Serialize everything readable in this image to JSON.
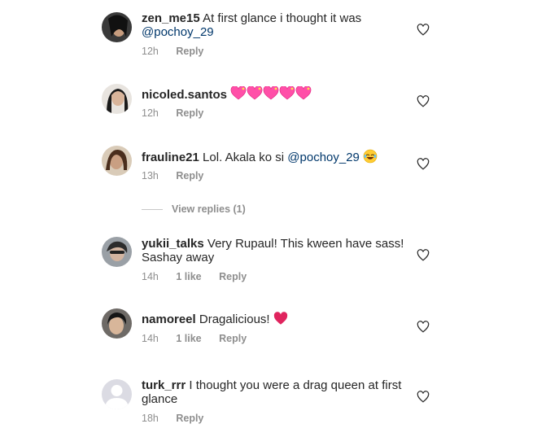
{
  "comments": [
    {
      "username": "zen_me15",
      "text": "At first glance i thought it was",
      "mention": "@pochoy_29",
      "time": "12h",
      "likes": "",
      "reply": "Reply"
    },
    {
      "username": "nicoled.santos",
      "text": "",
      "emoji": "5 sparkling pink hearts",
      "time": "12h",
      "likes": "",
      "reply": "Reply"
    },
    {
      "username": "frauline21",
      "text": "Lol. Akala ko si",
      "mention": "@pochoy_29",
      "emoji": "laughing face",
      "time": "13h",
      "likes": "",
      "reply": "Reply"
    },
    {
      "username": "yukii_talks",
      "text": "Very Rupaul! This kween have sass! Sashay away",
      "time": "14h",
      "likes": "1 like",
      "reply": "Reply"
    },
    {
      "username": "namoreel",
      "text": "Dragalicious!",
      "emoji": "red heart",
      "time": "14h",
      "likes": "1 like",
      "reply": "Reply"
    },
    {
      "username": "turk_rrr",
      "text": "I thought you were a drag queen at first glance",
      "time": "18h",
      "likes": "",
      "reply": "Reply"
    }
  ],
  "view_replies": "View replies (1)",
  "icons": {
    "like": "heart-outline-icon"
  },
  "colors": {
    "text": "#262626",
    "meta": "#8e8e8e",
    "mention": "#00376b",
    "heart_emoji": "#e0245e",
    "pink": "#ff5fb3"
  }
}
